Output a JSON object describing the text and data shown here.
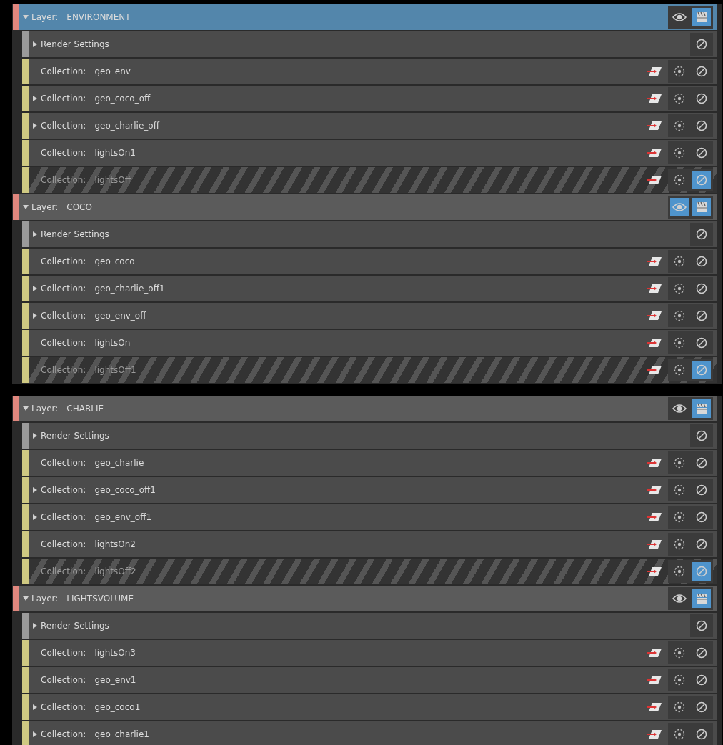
{
  "panels": [
    {
      "layers": [
        {
          "label": "Layer:",
          "name": "ENVIRONMENT",
          "expanded": true,
          "selected": true,
          "visible": false,
          "renderable": true,
          "items": [
            {
              "kind": "render_settings",
              "label": "Render Settings",
              "has_children": true
            },
            {
              "kind": "collection",
              "label": "Collection:",
              "name": "geo_env",
              "has_children": false,
              "disabled": false
            },
            {
              "kind": "collection",
              "label": "Collection:",
              "name": "geo_coco_off",
              "has_children": true,
              "disabled": false
            },
            {
              "kind": "collection",
              "label": "Collection:",
              "name": "geo_charlie_off",
              "has_children": true,
              "disabled": false
            },
            {
              "kind": "collection",
              "label": "Collection:",
              "name": "lightsOn1",
              "has_children": false,
              "disabled": false
            },
            {
              "kind": "collection",
              "label": "Collection:",
              "name": "lightsOff",
              "has_children": false,
              "disabled": true
            }
          ]
        },
        {
          "label": "Layer:",
          "name": "COCO",
          "expanded": true,
          "selected": false,
          "visible": true,
          "renderable": true,
          "items": [
            {
              "kind": "render_settings",
              "label": "Render Settings",
              "has_children": true
            },
            {
              "kind": "collection",
              "label": "Collection:",
              "name": "geo_coco",
              "has_children": false,
              "disabled": false
            },
            {
              "kind": "collection",
              "label": "Collection:",
              "name": "geo_charlie_off1",
              "has_children": true,
              "disabled": false
            },
            {
              "kind": "collection",
              "label": "Collection:",
              "name": "geo_env_off",
              "has_children": true,
              "disabled": false
            },
            {
              "kind": "collection",
              "label": "Collection:",
              "name": "lightsOn",
              "has_children": false,
              "disabled": false
            },
            {
              "kind": "collection",
              "label": "Collection:",
              "name": "lightsOff1",
              "has_children": false,
              "disabled": true
            }
          ]
        }
      ]
    },
    {
      "layers": [
        {
          "label": "Layer:",
          "name": "CHARLIE",
          "expanded": true,
          "selected": false,
          "visible": false,
          "renderable": true,
          "items": [
            {
              "kind": "render_settings",
              "label": "Render Settings",
              "has_children": true
            },
            {
              "kind": "collection",
              "label": "Collection:",
              "name": "geo_charlie",
              "has_children": false,
              "disabled": false
            },
            {
              "kind": "collection",
              "label": "Collection:",
              "name": "geo_coco_off1",
              "has_children": true,
              "disabled": false
            },
            {
              "kind": "collection",
              "label": "Collection:",
              "name": "geo_env_off1",
              "has_children": true,
              "disabled": false
            },
            {
              "kind": "collection",
              "label": "Collection:",
              "name": "lightsOn2",
              "has_children": false,
              "disabled": false
            },
            {
              "kind": "collection",
              "label": "Collection:",
              "name": "lightsOff2",
              "has_children": false,
              "disabled": true
            }
          ]
        },
        {
          "label": "Layer:",
          "name": "LIGHTSVOLUME",
          "expanded": true,
          "selected": false,
          "visible": false,
          "renderable": true,
          "items": [
            {
              "kind": "render_settings",
              "label": "Render Settings",
              "has_children": true
            },
            {
              "kind": "collection",
              "label": "Collection:",
              "name": "lightsOn3",
              "has_children": false,
              "disabled": false
            },
            {
              "kind": "collection",
              "label": "Collection:",
              "name": "geo_env1",
              "has_children": false,
              "disabled": false
            },
            {
              "kind": "collection",
              "label": "Collection:",
              "name": "geo_coco1",
              "has_children": true,
              "disabled": false
            },
            {
              "kind": "collection",
              "label": "Collection:",
              "name": "geo_charlie1",
              "has_children": true,
              "disabled": false
            }
          ]
        }
      ]
    }
  ]
}
